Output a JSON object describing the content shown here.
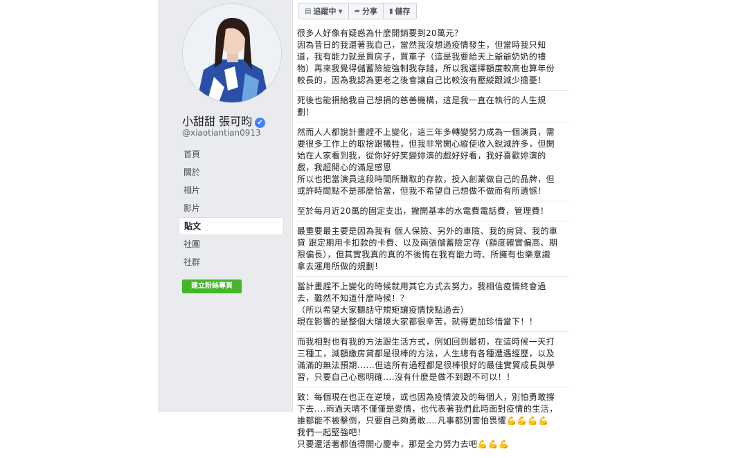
{
  "profile": {
    "name": "小甜甜 張可昀",
    "handle": "@xiaotiantian0913",
    "verified_glyph": "✔"
  },
  "nav": {
    "items": [
      {
        "label": "首頁"
      },
      {
        "label": "關於"
      },
      {
        "label": "相片"
      },
      {
        "label": "影片"
      },
      {
        "label": "貼文"
      },
      {
        "label": "社團"
      },
      {
        "label": "社群"
      }
    ],
    "active_index": 4,
    "create_page_label": "建立粉絲專頁"
  },
  "toolbar": {
    "follow_label": "追蹤中",
    "share_label": "分享",
    "save_label": "儲存"
  },
  "post": {
    "paragraphs": [
      [
        "很多人好像有疑惑為什麼開銷要到20萬元？",
        "因為昔日的我還著我自己，當然我沒想過疫情發生，但當時我只知",
        "道，我有能力就是買房子，買車子（這是我要給天上爺爺奶奶的禮",
        "物）再來我覺得儲蓄險能強制我存錢，所以我選擇額度較高也算年份",
        "較長的，因為我認為更老之後會讓自己比較沒有壓縱跟減少擔憂！"
      ],
      [
        "死後也能捐給我自己想捐的慈善機構，這是我一直在執行的人生規",
        "劃！"
      ],
      [
        "然而人人都說計畫趕不上變化，這三年多轉變努力成為一個演員，需",
        "要很多工作上的取捨跟犧牲，但我非常開心縱使收入銳減許多，但開",
        "始在人家看到我，從你好好笑變妳演的戲好好看，我好喜歡妳演的",
        "戲，我超開心的滿是感恩",
        "所以也把當演員這段時間所賺取的存款，投入創業做自己的品牌，但",
        "或許時間點不是那麼恰當，但我不希望自己想做不做而有所遺憾！"
      ],
      [
        "至於每月近20萬的固定支出，撇開基本的水電費電話費，管理費！"
      ],
      [
        "最重要最主要是因為我有 個人保險、另外的車險、我的房貸、我的車",
        "貸 跟定期用卡扣款的卡費、以及兩張儲蓄險定存（額度確實偏高、期",
        "限偏長），但其實我真的真的不後悔在我有能力時、所擁有也樂意識",
        "拿去運用所做的規劃！"
      ],
      [
        "當計畫趕不上變化的時候就用其它方式去努力，我相信疫情終會過",
        "去，雖然不知道什麼時候！？",
        "（所以希望大家聽話守規矩讓疫情快點過去）",
        "現在影響的是整個大環境大家都很辛苦，就得更加珍惜當下！！"
      ],
      [
        "而我相對也有我的方法跟生活方式，例如回到最初，在這時候一天打",
        "三種工，減額繳房貸都是很棒的方法，人生總有各種遭遇經歷，以及",
        "滿滿的無法預期......但這所有過程都是很棒很好的最佳實貿成長與學",
        "習，只要自己心態明確....沒有什麼是做不到跟不可以！！"
      ],
      [
        "致：每個現在也正在逆境，或也因為疫情波及的每個人，別怕勇敢撐",
        "下去....雨過天晴不僅僅是愛情，也代表著我們此時面對疫情的生活，",
        "誰都能不被擊倒，只要自己夠勇敢....凡事都別害怕畏懼💪💪💪💪",
        "我們一起堅強吧！",
        "只要還活著都值得開心慶幸，那是全力努力去吧💪💪💪"
      ]
    ]
  },
  "colors": {
    "page_bg": "#e9ebee",
    "accent_blue": "#4080ff",
    "create_green": "#42b72a"
  }
}
